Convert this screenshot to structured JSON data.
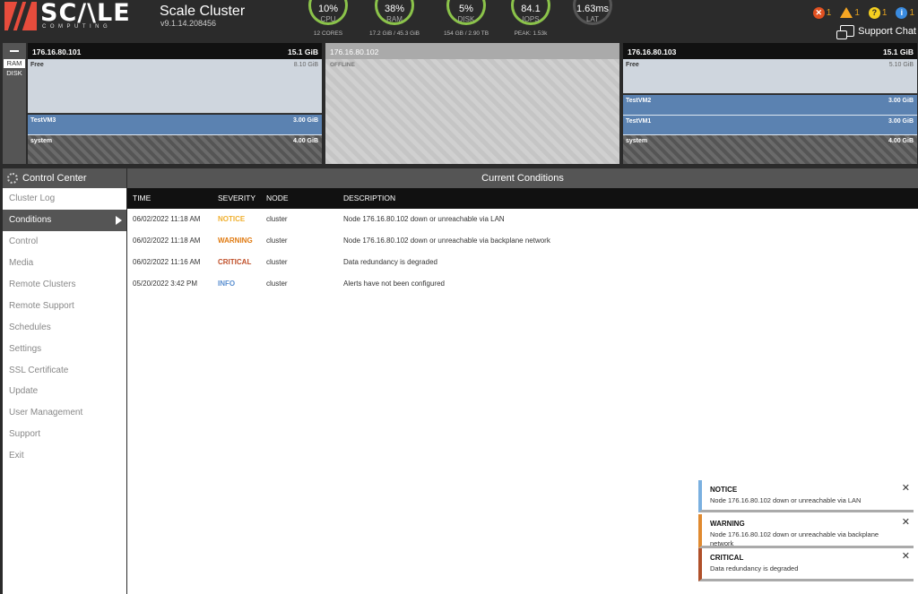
{
  "header": {
    "logo_text": "SC/\\LE",
    "logo_sub": "COMPUTING",
    "cluster_name": "Scale Cluster",
    "cluster_version": "v9.1.14.208456",
    "gauges": [
      {
        "value": "10%",
        "label": "CPU",
        "sub": "12 CORES",
        "color": "#8bc34a"
      },
      {
        "value": "38%",
        "label": "RAM",
        "sub": "17.2 GiB / 45.3 GiB",
        "color": "#8bc34a"
      },
      {
        "value": "5%",
        "label": "DISK",
        "sub": "154 GB / 2.90 TB",
        "color": "#8bc34a"
      },
      {
        "value": "84.1",
        "label": "IOPS",
        "sub": "PEAK: 1.53k",
        "color": "#8bc34a"
      },
      {
        "value": "1.63ms",
        "label": "LAT",
        "sub": "",
        "color": "#555555"
      }
    ],
    "alert_counts": {
      "critical": "1",
      "warning": "1",
      "question": "1",
      "info": "1"
    },
    "support_chat_label": "Support Chat"
  },
  "storage_mode": {
    "ram_label": "RAM",
    "disk_label": "DISK",
    "active": "RAM"
  },
  "nodes": [
    {
      "ip": "176.16.80.101",
      "memory": "15.1 GiB",
      "status": "online",
      "segments": [
        {
          "type": "free",
          "name": "Free",
          "size": "8.10 GiB"
        },
        {
          "type": "vm",
          "name": "TestVM3",
          "size": "3.00 GiB"
        },
        {
          "type": "system",
          "name": "system",
          "size": "4.00 GiB"
        }
      ]
    },
    {
      "ip": "176.16.80.102",
      "memory": "",
      "status": "offline",
      "offline_label": "OFFLINE"
    },
    {
      "ip": "176.16.80.103",
      "memory": "15.1 GiB",
      "status": "online",
      "segments": [
        {
          "type": "free",
          "name": "Free",
          "size": "5.10 GiB"
        },
        {
          "type": "vm",
          "name": "TestVM2",
          "size": "3.00 GiB"
        },
        {
          "type": "vm",
          "name": "TestVM1",
          "size": "3.00 GiB"
        },
        {
          "type": "system",
          "name": "system",
          "size": "4.00 GiB"
        }
      ]
    }
  ],
  "sidebar": {
    "title": "Control Center",
    "items": [
      {
        "label": "Cluster Log",
        "id": "cluster-log",
        "active": false
      },
      {
        "label": "Conditions",
        "id": "conditions",
        "active": true
      },
      {
        "label": "Control",
        "id": "control",
        "active": false
      },
      {
        "label": "Media",
        "id": "media",
        "active": false
      },
      {
        "label": "Remote Clusters",
        "id": "remote-clusters",
        "active": false
      },
      {
        "label": "Remote Support",
        "id": "remote-support",
        "active": false
      },
      {
        "label": "Schedules",
        "id": "schedules",
        "active": false
      },
      {
        "label": "Settings",
        "id": "settings",
        "active": false
      },
      {
        "label": "SSL Certificate",
        "id": "ssl-certificate",
        "active": false
      },
      {
        "label": "Update",
        "id": "update",
        "active": false
      },
      {
        "label": "User Management",
        "id": "user-management",
        "active": false
      },
      {
        "label": "Support",
        "id": "support",
        "active": false
      },
      {
        "label": "Exit",
        "id": "exit",
        "active": false
      }
    ]
  },
  "conditions": {
    "title": "Current Conditions",
    "columns": {
      "time": "TIME",
      "severity": "SEVERITY",
      "node": "NODE",
      "description": "DESCRIPTION"
    },
    "rows": [
      {
        "time": "06/02/2022 11:18 AM",
        "severity": "NOTICE",
        "node": "cluster",
        "description": "Node 176.16.80.102 down or unreachable via LAN"
      },
      {
        "time": "06/02/2022 11:18 AM",
        "severity": "WARNING",
        "node": "cluster",
        "description": "Node 176.16.80.102 down or unreachable via backplane network"
      },
      {
        "time": "06/02/2022 11:16 AM",
        "severity": "CRITICAL",
        "node": "cluster",
        "description": "Data redundancy is degraded"
      },
      {
        "time": "05/20/2022 3:42 PM",
        "severity": "INFO",
        "node": "cluster",
        "description": "Alerts have not been configured"
      }
    ],
    "severity_colors": {
      "NOTICE": "#f0b030",
      "WARNING": "#e07a10",
      "CRITICAL": "#c0502a",
      "INFO": "#5a8fd0"
    }
  },
  "toasts": [
    {
      "title": "NOTICE",
      "message": "Node 176.16.80.102 down or unreachable via LAN",
      "color": "#7ab0e0"
    },
    {
      "title": "WARNING",
      "message": "Node 176.16.80.102 down or unreachable via backplane network",
      "color": "#e08a30"
    },
    {
      "title": "CRITICAL",
      "message": "Data redundancy is degraded",
      "color": "#b0502a"
    }
  ]
}
